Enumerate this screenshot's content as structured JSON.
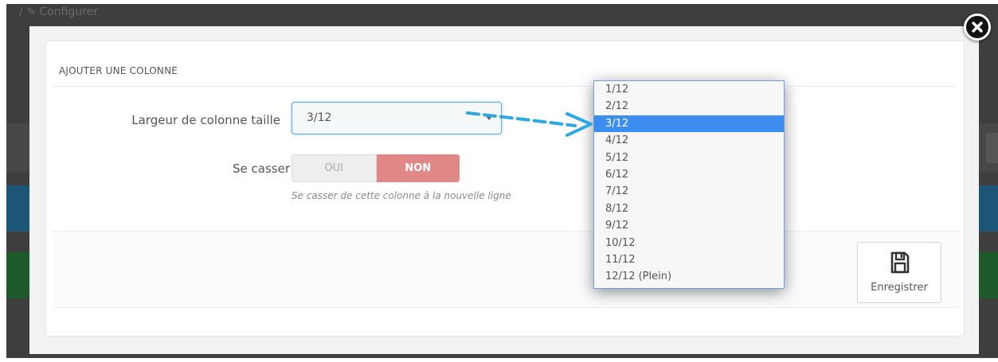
{
  "background": {
    "breadcrumb": "/ ✎ Configurer"
  },
  "modal": {
    "panel_title": "AJOUTER UNE COLONNE",
    "fields": {
      "width": {
        "label": "Largeur de colonne taille",
        "value": "3/12"
      },
      "break": {
        "label": "Se casser",
        "option_yes": "OUI",
        "option_no": "NON",
        "selected": "NON",
        "help": "Se casser de cette colonne à la nouvelle ligne"
      }
    },
    "save_button": {
      "label": "Enregistrer",
      "icon": "floppy-disk-icon"
    },
    "close_icon": "close-icon"
  },
  "dropdown": {
    "options": [
      "1/12",
      "2/12",
      "3/12",
      "4/12",
      "5/12",
      "6/12",
      "7/12",
      "8/12",
      "9/12",
      "10/12",
      "11/12",
      "12/12 (Plein)"
    ],
    "selected": "3/12"
  },
  "colors": {
    "accent_blue": "#3b8df0",
    "toggle_no": "#e08888",
    "arrow": "#2ea9e0"
  }
}
